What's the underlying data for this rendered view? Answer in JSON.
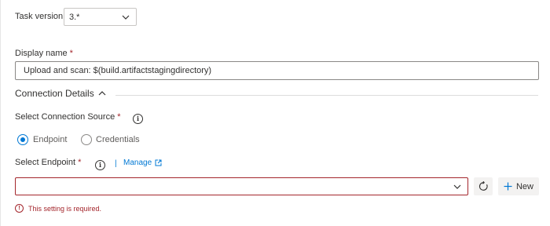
{
  "task_version": {
    "label": "Task version",
    "value": "3.*"
  },
  "display_name": {
    "label": "Display name",
    "required_mark": "*",
    "value": "Upload and scan: $(build.artifactstagingdirectory)"
  },
  "connection_details": {
    "title": "Connection Details"
  },
  "connection_source": {
    "label": "Select Connection Source",
    "required_mark": "*",
    "info_icon": "i",
    "options": [
      {
        "label": "Endpoint",
        "selected": true
      },
      {
        "label": "Credentials",
        "selected": false
      }
    ]
  },
  "endpoint": {
    "label": "Select Endpoint",
    "required_mark": "*",
    "info_icon": "i",
    "separator": "|",
    "manage_link": "Manage",
    "value": "",
    "new_button": "New",
    "error_icon": "!",
    "error": "This setting is required."
  },
  "colors": {
    "accent": "#0078d4",
    "error": "#a4262c",
    "text": "#323130"
  }
}
